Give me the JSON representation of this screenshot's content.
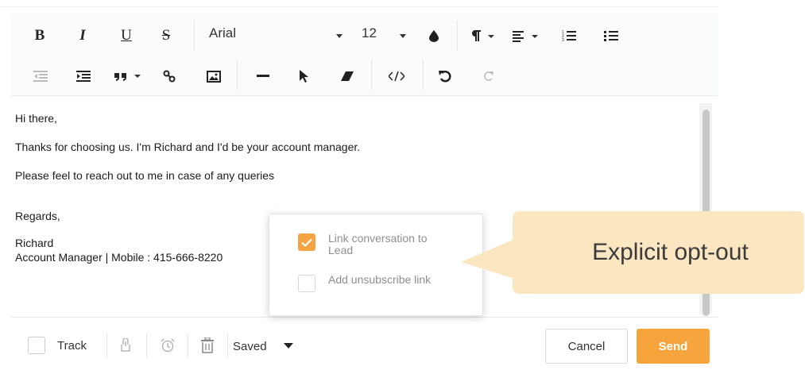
{
  "toolbar": {
    "bold": "B",
    "italic": "I",
    "underline": "U",
    "strike": "S",
    "font_family": "Arial",
    "font_size": "12"
  },
  "email_body": {
    "lines": [
      "Hi there,",
      "Thanks for choosing us. I'm Richard and I'd be your account manager.",
      "Please feel to reach out to me in case of any queries",
      "Regards,",
      "Richard",
      "Account Manager | Mobile : 415-666-8220"
    ]
  },
  "popup": {
    "link_conversation": {
      "label_line1": "Link conversation to",
      "label_line2": "Lead",
      "checked": true
    },
    "unsubscribe": {
      "label": "Add unsubscribe link",
      "checked": false
    }
  },
  "callout": {
    "text": "Explicit opt-out"
  },
  "footer": {
    "track_label": "Track",
    "saved_label": "Saved",
    "cancel_label": "Cancel",
    "send_label": "Send"
  },
  "colors": {
    "accent": "#f6a53c",
    "callout_bg": "#fbe6c2",
    "checkbox_checked": "#f4a442"
  }
}
